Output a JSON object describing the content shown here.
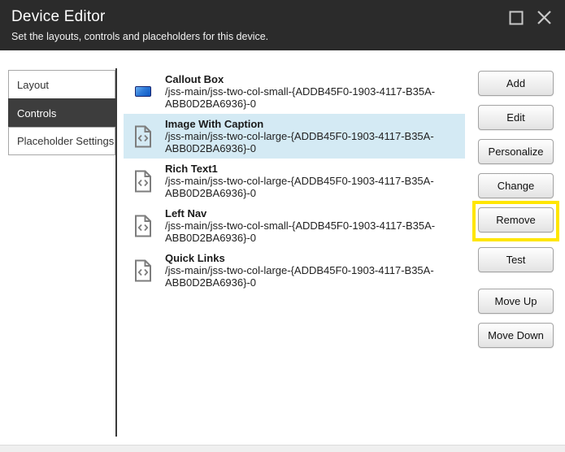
{
  "window": {
    "title": "Device Editor",
    "subtitle": "Set the layouts, controls and placeholders for this device.",
    "maximize_icon": "maximize-square",
    "close_icon": "close-x"
  },
  "tabs": {
    "selected": "Controls",
    "items": [
      {
        "label": "Layout"
      },
      {
        "label": "Controls"
      },
      {
        "label": "Placeholder Settings"
      }
    ]
  },
  "list": {
    "items": [
      {
        "name": "Callout Box",
        "path": "/jss-main/jss-two-col-small-{ADDB45F0-1903-4117-B35A-ABB0D2BA6936}-0",
        "icon": "blue-button-thumbnail",
        "selected": false
      },
      {
        "name": "Image With Caption",
        "path": "/jss-main/jss-two-col-large-{ADDB45F0-1903-4117-B35A-ABB0D2BA6936}-0",
        "icon": "code-file",
        "selected": true
      },
      {
        "name": "Rich Text1",
        "path": "/jss-main/jss-two-col-large-{ADDB45F0-1903-4117-B35A-ABB0D2BA6936}-0",
        "icon": "code-file",
        "selected": false
      },
      {
        "name": "Left Nav",
        "path": "/jss-main/jss-two-col-small-{ADDB45F0-1903-4117-B35A-ABB0D2BA6936}-0",
        "icon": "code-file",
        "selected": false
      },
      {
        "name": "Quick Links",
        "path": "/jss-main/jss-two-col-large-{ADDB45F0-1903-4117-B35A-ABB0D2BA6936}-0",
        "icon": "code-file",
        "selected": false
      }
    ]
  },
  "actions": {
    "highlighted": "Remove",
    "buttons": [
      {
        "label": "Add"
      },
      {
        "label": "Edit"
      },
      {
        "label": "Personalize"
      },
      {
        "label": "Change"
      },
      {
        "label": "Remove"
      },
      {
        "label": "Test"
      },
      {
        "label": "Move Up"
      },
      {
        "label": "Move Down"
      }
    ]
  },
  "colors": {
    "header_bg": "#2b2b2b",
    "selected_tab_bg": "#3d3d3d",
    "selected_row_bg": "#d4eaf4",
    "highlight_yellow": "#ffe600",
    "thumbnail_blue": "#0d57c4"
  }
}
